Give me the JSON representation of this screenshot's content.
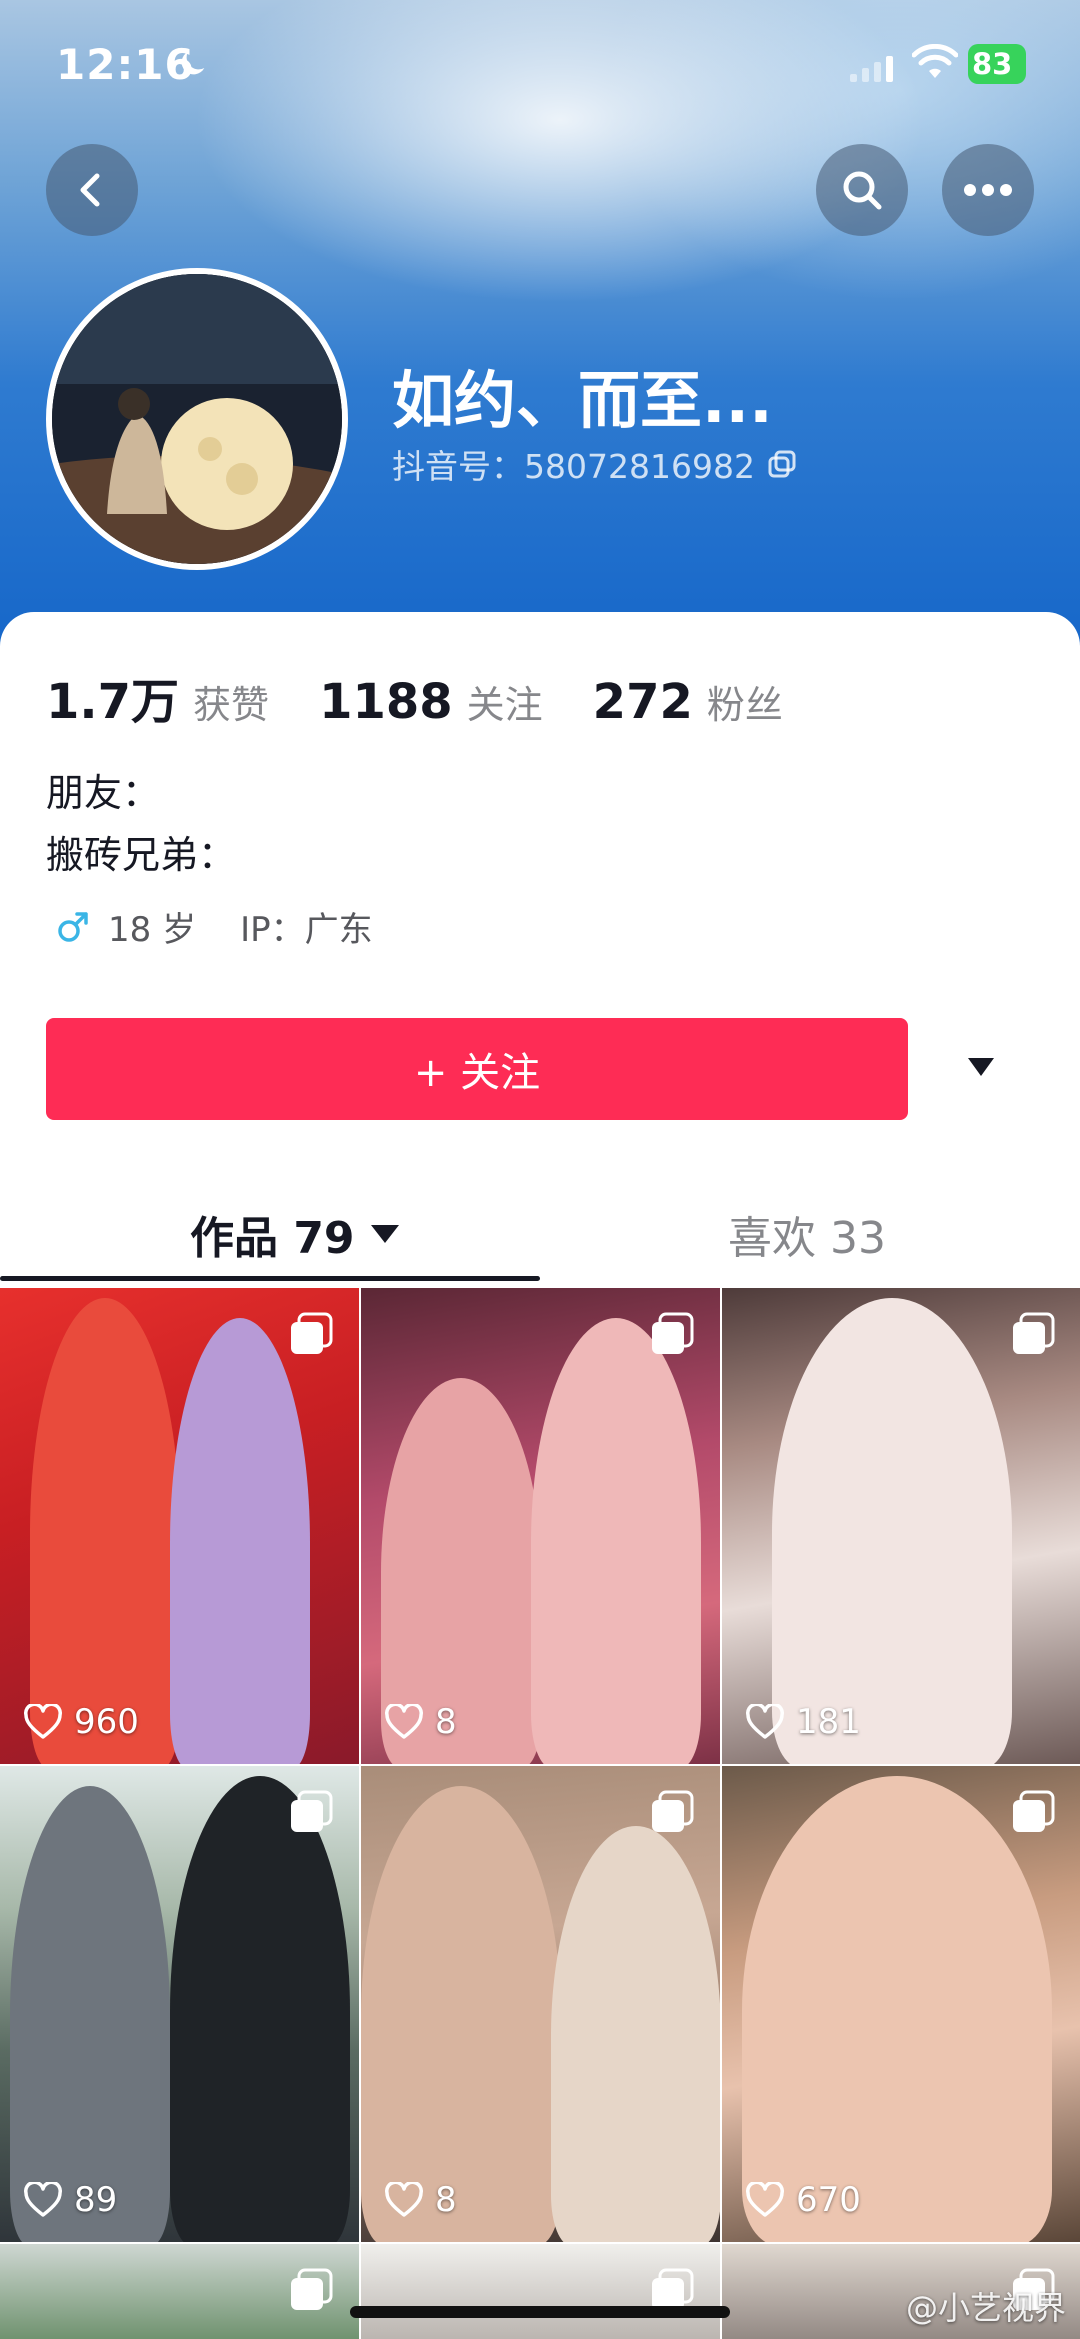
{
  "status_bar": {
    "time": "12:16",
    "battery": "83"
  },
  "profile": {
    "nickname": "如约、而至...",
    "douyin_id": "抖音号：58072816982"
  },
  "stats": [
    {
      "value": "1.7万",
      "label": "获赞"
    },
    {
      "value": "1188",
      "label": "关注"
    },
    {
      "value": "272",
      "label": "粉丝"
    }
  ],
  "bio": {
    "line1": "朋友：",
    "line2": "搬砖兄弟："
  },
  "meta": {
    "age": "18 岁",
    "ip": "IP：广东"
  },
  "follow_label": "+ 关注",
  "tabs": {
    "works": "作品 79",
    "likes": "喜欢 33"
  },
  "videos": [
    {
      "likes": "960"
    },
    {
      "likes": "8"
    },
    {
      "likes": "181"
    },
    {
      "likes": "89"
    },
    {
      "likes": "8"
    },
    {
      "likes": "670"
    }
  ],
  "watermark": "@小艺视界",
  "colors": {
    "accent": "#fe2c55",
    "header_blue": "#1566c9",
    "gender_blue": "#3ab5e6"
  }
}
